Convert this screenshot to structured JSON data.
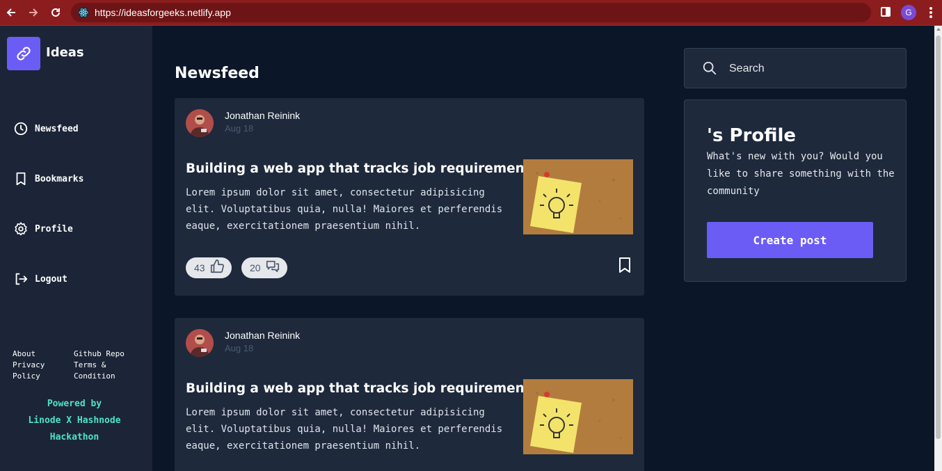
{
  "browser": {
    "url": "https://ideasforgeeks.netlify.app",
    "profile_initial": "G",
    "theme_color": "#8b1d1f"
  },
  "sidebar": {
    "logo_text": "Ideas",
    "nav": [
      {
        "label": "Newsfeed",
        "icon": "clock-icon"
      },
      {
        "label": "Bookmarks",
        "icon": "bookmark-icon"
      },
      {
        "label": "Profile",
        "icon": "gear-icon"
      },
      {
        "label": "Logout",
        "icon": "logout-icon"
      }
    ],
    "footer": {
      "about": "About",
      "privacy": "Privacy Policy",
      "github": "Github Repo",
      "terms": "Terms & Condition"
    },
    "powered_lines": [
      "Powered by",
      "Linode X Hashnode",
      "Hackathon"
    ]
  },
  "main": {
    "title": "Newsfeed",
    "posts": [
      {
        "author": "Jonathan Reinink",
        "date": "Aug 18",
        "title": "Building a web app that tracks job requirements?",
        "body": "Lorem ipsum dolor sit amet, consectetur adipisicing elit. Voluptatibus quia, nulla! Maiores et perferendis eaque, exercitationem praesentium nihil.",
        "likes": "43",
        "comments": "20"
      },
      {
        "author": "Jonathan Reinink",
        "date": "Aug 18",
        "title": "Building a web app that tracks job requirements?",
        "body": "Lorem ipsum dolor sit amet, consectetur adipisicing elit. Voluptatibus quia, nulla! Maiores et perferendis eaque, exercitationem praesentium nihil.",
        "likes": "",
        "comments": ""
      }
    ]
  },
  "right": {
    "search_placeholder": "Search",
    "profile_title": "'s Profile",
    "profile_desc": "What's new with you? Would you like to share something with the community",
    "create_button": "Create post"
  },
  "colors": {
    "accent": "#6c5cf6",
    "powered_text": "#4fe3c6",
    "card_bg": "#1e293b",
    "page_bg": "#0b1629"
  }
}
